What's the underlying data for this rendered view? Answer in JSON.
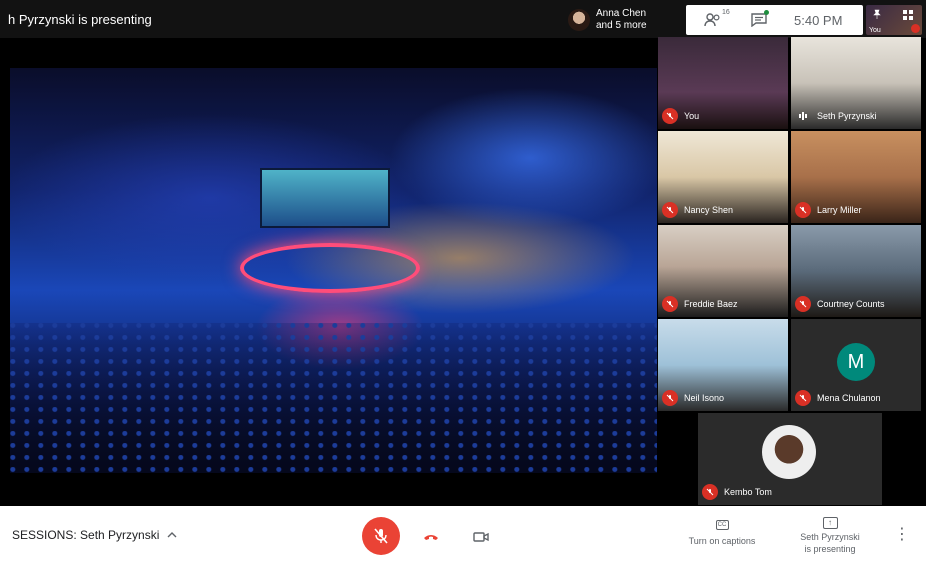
{
  "topbar": {
    "presenting_title": "h Pyrzynski is presenting",
    "people_chip": {
      "name": "Anna Chen",
      "more": "and 5 more"
    },
    "participants_count": "16",
    "clock": "5:40 PM",
    "self_label": "You"
  },
  "participants": [
    {
      "name": "You",
      "photo": "#5a3a55"
    },
    {
      "name": "Seth Pyrzynski",
      "photo": "#c8c2b8"
    },
    {
      "name": "Nancy Shen",
      "photo": "#d9c7a6"
    },
    {
      "name": "Larry Miller",
      "photo": "#a8704a"
    },
    {
      "name": "Freddie Baez",
      "photo": "#b9a596"
    },
    {
      "name": "Courtney Counts",
      "photo": "#5a6a7a"
    },
    {
      "name": "Neil Isono",
      "photo": "#9ec1d8"
    },
    {
      "name": "Mena Chulanon",
      "initial": "M",
      "color": "#00897b"
    },
    {
      "name": "Kembo Tom"
    }
  ],
  "bottombar": {
    "session_label": "SESSIONS: Seth Pyrzynski",
    "captions_label": "Turn on captions",
    "presenting_line1": "Seth Pyrzynski",
    "presenting_line2": "is presenting"
  },
  "colors": {
    "accent_red": "#ea4335",
    "tile_bg": "#2b2b2b",
    "avatar_teal": "#00897b"
  }
}
